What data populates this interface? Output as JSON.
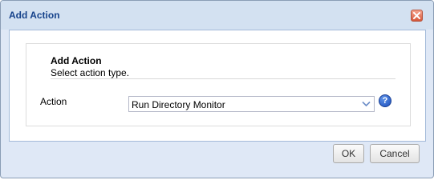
{
  "window": {
    "title": "Add Action",
    "close_icon": "close-icon"
  },
  "section": {
    "title": "Add Action",
    "subtitle": "Select action type."
  },
  "field": {
    "label": "Action",
    "selected_value": "Run Directory Monitor",
    "dropdown_icon": "chevron-down-icon",
    "help_icon": "help-icon",
    "help_glyph": "?"
  },
  "buttons": {
    "ok_label": "OK",
    "cancel_label": "Cancel"
  },
  "colors": {
    "title_text": "#15428b",
    "dialog_bg": "#dfe8f6",
    "close_button": "#d5573a",
    "help_icon": "#1c4fbd"
  }
}
